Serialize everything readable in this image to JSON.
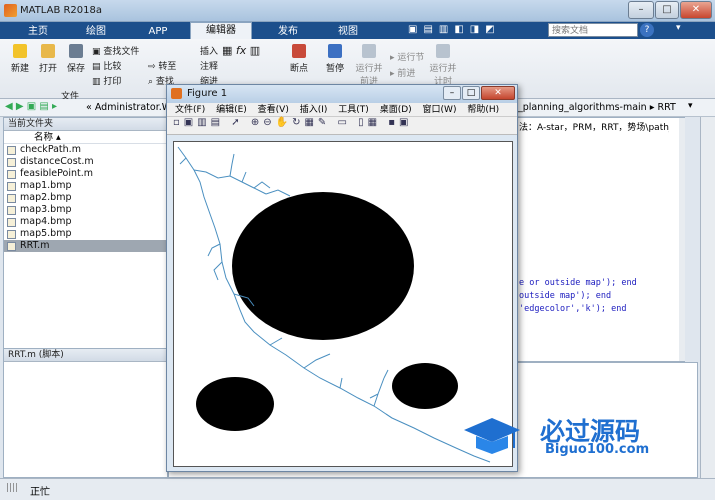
{
  "window": {
    "title": "MATLAB R2018a",
    "buttons": [
      "–",
      "□",
      "✕"
    ]
  },
  "tabs": [
    {
      "label": "主页"
    },
    {
      "label": "绘图"
    },
    {
      "label": "APP"
    },
    {
      "label": "编辑器"
    },
    {
      "label": "发布"
    },
    {
      "label": "视图"
    }
  ],
  "search": {
    "placeholder": "搜索文档"
  },
  "ribbon": {
    "new": "新建",
    "open": "打开",
    "save": "保存",
    "find_files": "查找文件",
    "compare": "比较",
    "print": "打印",
    "goto": "转至",
    "find": "查找",
    "insert": "插入",
    "comment": "注释",
    "indent": "缩进",
    "breakpoints": "断点",
    "run": "运行",
    "run_advance": "运行并\n前进",
    "run_section": "运行节",
    "advance": "前进",
    "run_time": "运行并\n计时",
    "group_file": "文件"
  },
  "address": {
    "path": "Administrator.WIN",
    "right_path": "_planning_algorithms-main ▸ RRT"
  },
  "current_folder": {
    "header": "当前文件夹",
    "column": "名称",
    "files": [
      {
        "name": "checkPath.m",
        "selected": false
      },
      {
        "name": "distanceCost.m",
        "selected": false
      },
      {
        "name": "feasiblePoint.m",
        "selected": false
      },
      {
        "name": "map1.bmp",
        "selected": false
      },
      {
        "name": "map2.bmp",
        "selected": false
      },
      {
        "name": "map3.bmp",
        "selected": false
      },
      {
        "name": "map4.bmp",
        "selected": false
      },
      {
        "name": "map5.bmp",
        "selected": false
      },
      {
        "name": "RRT.m",
        "selected": true
      }
    ]
  },
  "details": {
    "label": "RRT.m  (脚本)"
  },
  "editor": {
    "tab_text": "法：A-star，PRM，RRT，势场\\path_...",
    "lines": [
      "e or outside map'); end",
      "outside map'); end",
      "'edgecolor','k'); end"
    ]
  },
  "status": {
    "text": "正忙"
  },
  "figure": {
    "title": "Figure 1",
    "menu": [
      "文件(F)",
      "编辑(E)",
      "查看(V)",
      "插入(I)",
      "工具(T)",
      "桌面(D)",
      "窗口(W)",
      "帮助(H)"
    ],
    "buttons": [
      "–",
      "□",
      "✕"
    ]
  },
  "watermark": {
    "text1": "必过源码",
    "text2": "Biguo100.com"
  }
}
